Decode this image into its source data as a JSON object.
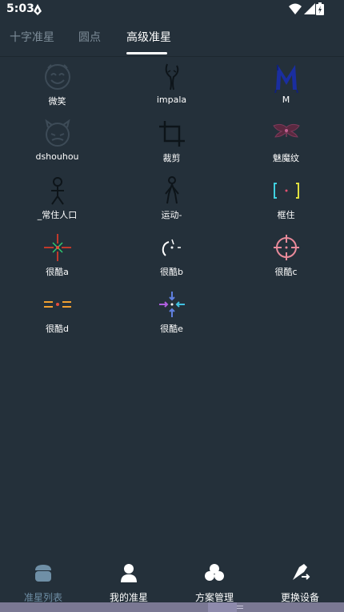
{
  "status_bar": {
    "time": "5:03"
  },
  "tabs": [
    {
      "label": "十字准星"
    },
    {
      "label": "圆点"
    },
    {
      "label": "高级准星"
    }
  ],
  "active_tab": "高级准星",
  "crosshairs": [
    {
      "label": "微笑",
      "icon": "smiley-crosshair-icon"
    },
    {
      "label": "impala",
      "icon": "impala-crosshair-icon"
    },
    {
      "label": "M",
      "icon": "m-letter-crosshair-icon"
    },
    {
      "label": "dshouhou",
      "icon": "devil-face-crosshair-icon"
    },
    {
      "label": "裁剪",
      "icon": "crop-crosshair-icon"
    },
    {
      "label": "魅魔纹",
      "icon": "succubus-mark-crosshair-icon"
    },
    {
      "label": "_常住人口",
      "icon": "stick-figure-crosshair-icon"
    },
    {
      "label": "运动-",
      "icon": "running-figure-crosshair-icon"
    },
    {
      "label": "框住",
      "icon": "bracket-frame-crosshair-icon"
    },
    {
      "label": "很酷a",
      "icon": "cool-a-crosshair-icon"
    },
    {
      "label": "很酷b",
      "icon": "cool-b-crosshair-icon"
    },
    {
      "label": "很酷c",
      "icon": "cool-c-crosshair-icon"
    },
    {
      "label": "很酷d",
      "icon": "cool-d-crosshair-icon"
    },
    {
      "label": "很酷e",
      "icon": "cool-e-crosshair-icon"
    }
  ],
  "bottom_nav": [
    {
      "label": "准星列表",
      "icon": "crosshair-list-icon",
      "active": true
    },
    {
      "label": "我的准星",
      "icon": "user-icon",
      "active": false
    },
    {
      "label": "方案管理",
      "icon": "clover-icon",
      "active": false
    },
    {
      "label": "更换设备",
      "icon": "swap-device-icon",
      "active": false
    }
  ],
  "colors": {
    "background": "#24303a",
    "active_nav": "#6f8fa6",
    "inactive_tab": "#7d8c98",
    "gesture_bar": "#7a7893"
  }
}
